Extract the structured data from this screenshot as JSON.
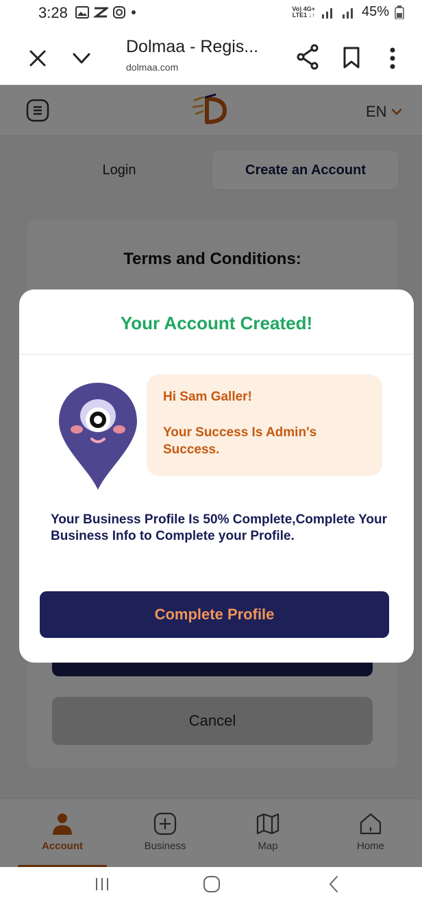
{
  "status_bar": {
    "time": "3:28",
    "net_top": "Vo) 4G+",
    "net_bottom": "LTE1 ↓↑",
    "battery": "45%"
  },
  "browser": {
    "title": "Dolmaa - Regis...",
    "url": "dolmaa.com"
  },
  "site": {
    "language": "EN",
    "tabs": [
      {
        "label": "Login"
      },
      {
        "label": "Create an Account"
      }
    ],
    "terms_title": "Terms and Conditions:",
    "cancel_label": "Cancel"
  },
  "modal": {
    "title": "Your Account Created!",
    "greeting": "Hi Sam Galler!",
    "message": "Your Success Is Admin's Success.",
    "profile_note": "Your Business Profile Is 50% Complete,Complete Your Business Info to Complete your Profile.",
    "button_label": "Complete Profile"
  },
  "bottom_nav": {
    "items": [
      {
        "label": "Account",
        "icon": "account-icon",
        "active": true
      },
      {
        "label": "Business",
        "icon": "plus-icon",
        "active": false
      },
      {
        "label": "Map",
        "icon": "map-icon",
        "active": false
      },
      {
        "label": "Home",
        "icon": "home-icon",
        "active": false
      }
    ]
  },
  "colors": {
    "brand_navy": "#1e2058",
    "accent_orange": "#c55a11",
    "success_green": "#1fa760"
  }
}
